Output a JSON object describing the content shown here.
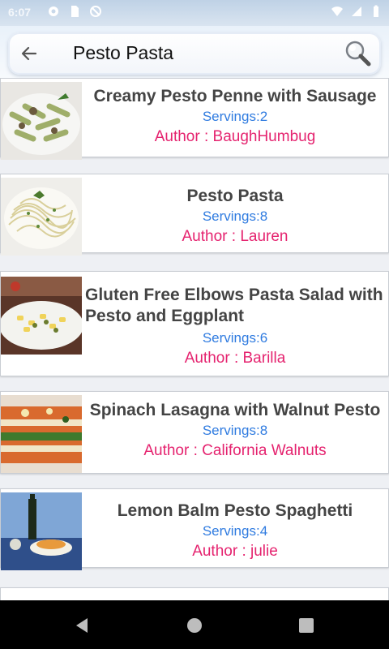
{
  "status_bar": {
    "time": "6:07"
  },
  "search": {
    "query": "Pesto Pasta"
  },
  "recipes": [
    {
      "title": "Creamy Pesto Penne with Sausage",
      "servings": "Servings:2",
      "author": "Author : BaughHumbug"
    },
    {
      "title": "Pesto Pasta",
      "servings": "Servings:8",
      "author": "Author : Lauren"
    },
    {
      "title": "Gluten Free Elbows Pasta Salad with Pesto and Eggplant",
      "servings": "Servings:6",
      "author": "Author : Barilla"
    },
    {
      "title": "Spinach Lasagna with Walnut Pesto",
      "servings": "Servings:8",
      "author": "Author : California Walnuts"
    },
    {
      "title": "Lemon Balm Pesto Spaghetti",
      "servings": "Servings:4",
      "author": "Author : julie"
    }
  ],
  "icons": {
    "back": "arrow-left-icon",
    "search": "magnifier-icon",
    "nav_back": "triangle-back-icon",
    "nav_home": "circle-home-icon",
    "nav_recents": "square-recents-icon"
  },
  "colors": {
    "servings": "#2f7be0",
    "author": "#e5236f",
    "title": "#444444"
  }
}
